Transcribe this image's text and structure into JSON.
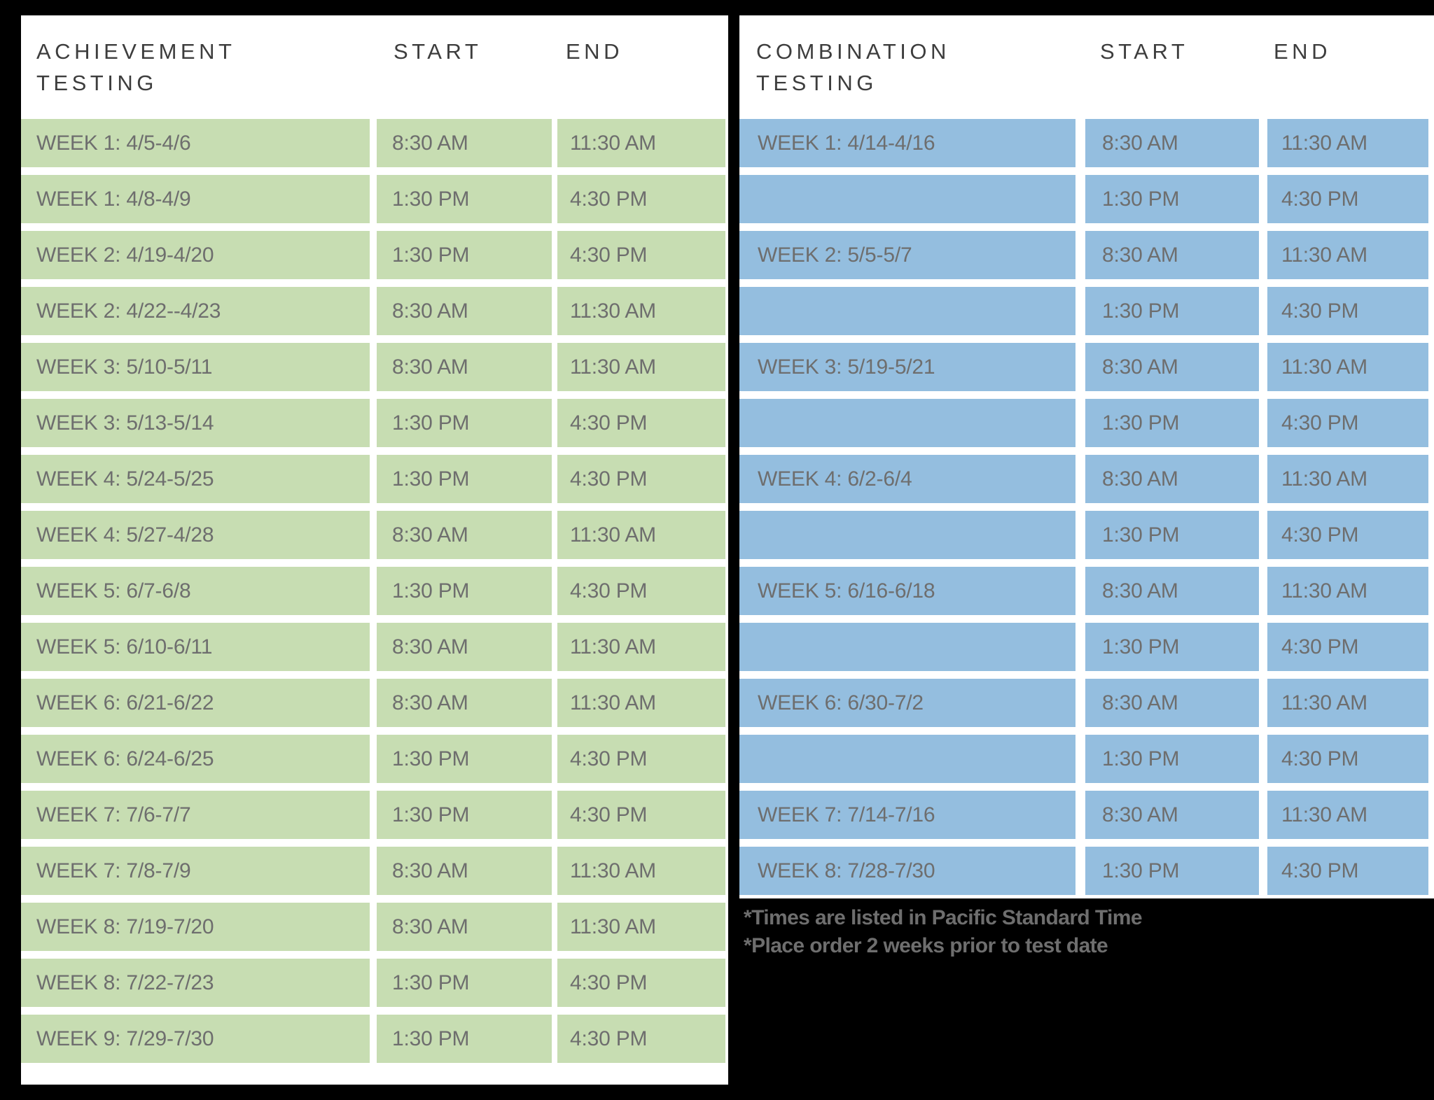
{
  "colors": {
    "background": "#000000",
    "panel": "#ffffff",
    "achievement_row": "#c7ddb2",
    "combination_row": "#94bedf",
    "cell_text": "#6e6e6e",
    "header_text": "#3d3d3d"
  },
  "achievement": {
    "headers": {
      "week": "ACHIEVEMENT\nTESTING",
      "start": "START",
      "end": "END"
    },
    "rows": [
      {
        "week": "WEEK 1: 4/5-4/6",
        "start": "8:30 AM",
        "end": "11:30 AM"
      },
      {
        "week": "WEEK 1: 4/8-4/9",
        "start": "1:30 PM",
        "end": "4:30 PM"
      },
      {
        "week": "WEEK 2: 4/19-4/20",
        "start": "1:30 PM",
        "end": "4:30 PM"
      },
      {
        "week": "WEEK 2: 4/22--4/23",
        "start": "8:30 AM",
        "end": "11:30 AM"
      },
      {
        "week": "WEEK 3: 5/10-5/11",
        "start": "8:30 AM",
        "end": "11:30 AM"
      },
      {
        "week": "WEEK 3: 5/13-5/14",
        "start": "1:30 PM",
        "end": "4:30 PM"
      },
      {
        "week": "WEEK 4: 5/24-5/25",
        "start": "1:30 PM",
        "end": "4:30 PM"
      },
      {
        "week": "WEEK 4: 5/27-4/28",
        "start": "8:30 AM",
        "end": "11:30 AM"
      },
      {
        "week": "WEEK 5: 6/7-6/8",
        "start": "1:30 PM",
        "end": "4:30 PM"
      },
      {
        "week": "WEEK 5: 6/10-6/11",
        "start": "8:30 AM",
        "end": "11:30 AM"
      },
      {
        "week": "WEEK 6: 6/21-6/22",
        "start": "8:30 AM",
        "end": "11:30 AM"
      },
      {
        "week": "WEEK 6: 6/24-6/25",
        "start": "1:30 PM",
        "end": "4:30 PM"
      },
      {
        "week": "WEEK 7: 7/6-7/7",
        "start": "1:30 PM",
        "end": "4:30 PM"
      },
      {
        "week": "WEEK 7: 7/8-7/9",
        "start": "8:30 AM",
        "end": "11:30 AM"
      },
      {
        "week": "WEEK 8: 7/19-7/20",
        "start": "8:30 AM",
        "end": "11:30 AM"
      },
      {
        "week": "WEEK 8: 7/22-7/23",
        "start": "1:30 PM",
        "end": "4:30 PM"
      },
      {
        "week": "WEEK 9: 7/29-7/30",
        "start": "1:30 PM",
        "end": "4:30 PM"
      }
    ]
  },
  "combination": {
    "headers": {
      "week": "COMBINATION\nTESTING",
      "start": "START",
      "end": "END"
    },
    "rows": [
      {
        "week": "WEEK 1: 4/14-4/16",
        "start": "8:30 AM",
        "end": "11:30 AM"
      },
      {
        "week": "",
        "start": "1:30 PM",
        "end": "4:30 PM"
      },
      {
        "week": "WEEK 2: 5/5-5/7",
        "start": "8:30 AM",
        "end": "11:30 AM"
      },
      {
        "week": "",
        "start": "1:30 PM",
        "end": "4:30 PM"
      },
      {
        "week": "WEEK 3: 5/19-5/21",
        "start": "8:30 AM",
        "end": "11:30 AM"
      },
      {
        "week": "",
        "start": "1:30 PM",
        "end": "4:30 PM"
      },
      {
        "week": "WEEK 4: 6/2-6/4",
        "start": "8:30 AM",
        "end": "11:30 AM"
      },
      {
        "week": "",
        "start": "1:30 PM",
        "end": "4:30 PM"
      },
      {
        "week": "WEEK 5: 6/16-6/18",
        "start": "8:30 AM",
        "end": "11:30 AM"
      },
      {
        "week": "",
        "start": "1:30 PM",
        "end": "4:30 PM"
      },
      {
        "week": "WEEK 6: 6/30-7/2",
        "start": "8:30 AM",
        "end": "11:30 AM"
      },
      {
        "week": "",
        "start": "1:30 PM",
        "end": "4:30 PM"
      },
      {
        "week": "WEEK 7: 7/14-7/16",
        "start": "8:30 AM",
        "end": "11:30 AM"
      },
      {
        "week": "WEEK 8: 7/28-7/30",
        "start": "1:30 PM",
        "end": "4:30 PM"
      }
    ]
  },
  "footnotes": [
    "*Times are listed in Pacific Standard Time",
    "*Place order 2 weeks prior to test date"
  ]
}
